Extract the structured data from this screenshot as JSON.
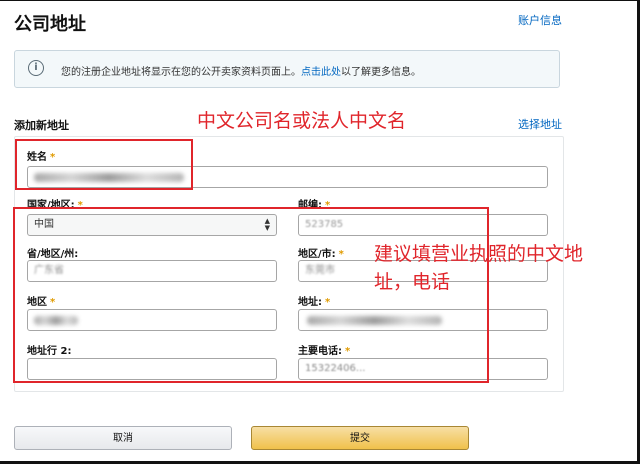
{
  "header": {
    "title": "公司地址",
    "account_link": "账户信息"
  },
  "info": {
    "icon": "info-icon",
    "text_before": "您的注册企业地址将显示在您的公开卖家资料页面上。",
    "link": "点击此处",
    "text_after": "以了解更多信息。"
  },
  "section": {
    "title": "添加新地址",
    "select_address_link": "选择地址"
  },
  "required_mark": "*",
  "form": {
    "name": {
      "label": "姓名"
    },
    "country": {
      "label": "国家/地区:",
      "value": "中国"
    },
    "postcode": {
      "label": "邮编:",
      "value": "523785"
    },
    "province": {
      "label": "省/地区/州:",
      "value": "广东省"
    },
    "city": {
      "label": "地区/市:",
      "value": "东莞市"
    },
    "district": {
      "label": "地区"
    },
    "address": {
      "label": "地址:"
    },
    "address_line2": {
      "label": "地址行 2:",
      "value": ""
    },
    "phone": {
      "label": "主要电话:",
      "value": "15322406..."
    }
  },
  "annotations": {
    "name_hint": "中文公司名或法人中文名",
    "address_hint_line1": "建议填营业执照的中文地",
    "address_hint_line2": "址，电话"
  },
  "buttons": {
    "cancel": "取消",
    "submit": "提交"
  },
  "colors": {
    "annotation_red": "#e0252b",
    "link_blue": "#0066c0",
    "required_orange": "#e09b00",
    "submit_yellow": "#f0c14b"
  }
}
